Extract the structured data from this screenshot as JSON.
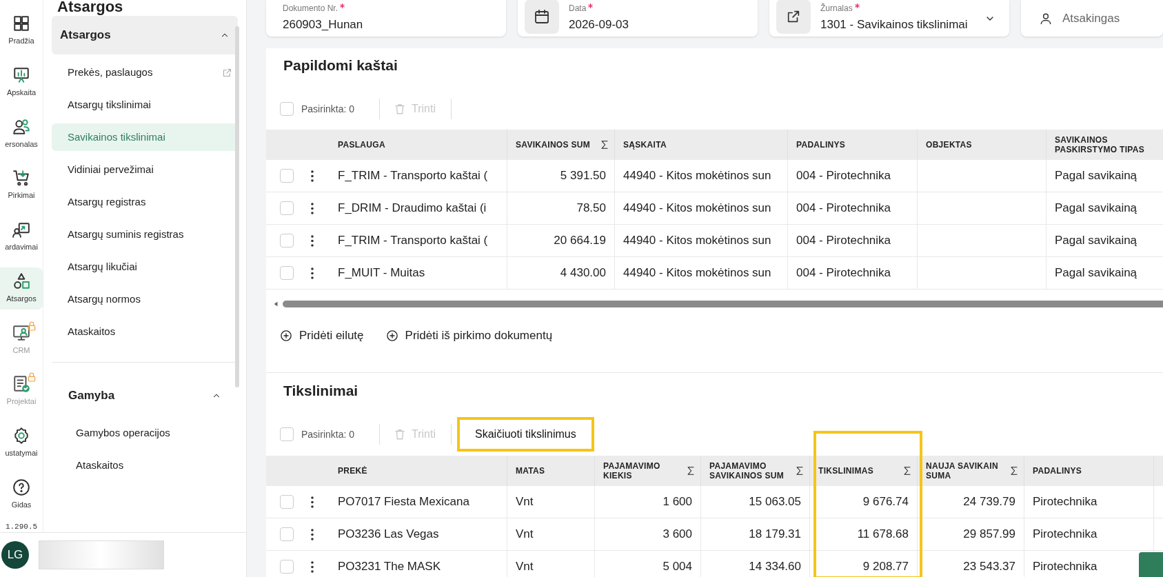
{
  "rail": {
    "items": [
      {
        "label": "Pradžia",
        "selected": false,
        "locked": false
      },
      {
        "label": "Apskaita",
        "selected": false,
        "locked": false
      },
      {
        "label": "ersonalas",
        "selected": false,
        "locked": false
      },
      {
        "label": "Pirkimai",
        "selected": false,
        "locked": false
      },
      {
        "label": "ardavimai",
        "selected": false,
        "locked": false
      },
      {
        "label": "Atsargos",
        "selected": true,
        "locked": false
      },
      {
        "label": "CRM",
        "selected": false,
        "locked": true
      },
      {
        "label": "Projektai",
        "selected": false,
        "locked": true
      },
      {
        "label": "ustatymai",
        "selected": false,
        "locked": false
      },
      {
        "label": "Gidas",
        "selected": false,
        "locked": false
      }
    ],
    "version": "1.290.5"
  },
  "sidebar": {
    "title": "Atsargos",
    "groups": [
      {
        "title": "Atsargos",
        "expanded": true,
        "items": [
          {
            "label": "Prekės, paslaugos",
            "selected": false,
            "external": true
          },
          {
            "label": "Atsargų tikslinimai",
            "selected": false,
            "external": false
          },
          {
            "label": "Savikainos tikslinimai",
            "selected": true,
            "external": false
          },
          {
            "label": "Vidiniai pervežimai",
            "selected": false,
            "external": false
          },
          {
            "label": "Atsargų registras",
            "selected": false,
            "external": false
          },
          {
            "label": "Atsargų suminis registras",
            "selected": false,
            "external": false
          },
          {
            "label": "Atsargų likučiai",
            "selected": false,
            "external": false
          },
          {
            "label": "Atsargų normos",
            "selected": false,
            "external": false
          },
          {
            "label": "Ataskaitos",
            "selected": false,
            "external": false
          }
        ]
      },
      {
        "title": "Gamyba",
        "expanded": true,
        "items": [
          {
            "label": "Gamybos operacijos",
            "selected": false,
            "external": false
          },
          {
            "label": "Ataskaitos",
            "selected": false,
            "external": false
          }
        ]
      }
    ]
  },
  "user": {
    "initials": "LG"
  },
  "header_fields": [
    {
      "kind": "text",
      "label": "Dokumento Nr.",
      "required": true,
      "value": "260903_Hunan"
    },
    {
      "kind": "date",
      "label": "Data",
      "required": true,
      "value": "2026-09-03"
    },
    {
      "kind": "select",
      "label": "Žurnalas",
      "required": true,
      "value": "1301 - Savikainos tikslinimai"
    },
    {
      "kind": "person",
      "placeholder": "Atsakingas"
    }
  ],
  "extra_costs": {
    "title": "Papildomi kaštai",
    "all_checked": false,
    "selected_count": "Pasirinkta: 0",
    "delete": "Trinti",
    "columns": [
      {
        "label": "PASLAUGA",
        "sum": false,
        "kind": "text"
      },
      {
        "label": "SAVIKAINOS SUM",
        "sum": true,
        "kind": "number"
      },
      {
        "label": "SĄSKAITA",
        "sum": false,
        "kind": "text"
      },
      {
        "label": "PADALINYS",
        "sum": false,
        "kind": "text"
      },
      {
        "label": "OBJEKTAS",
        "sum": false,
        "kind": "text"
      },
      {
        "label": "SAVIKAINOS\nPASKIRSTYMO TIPAS",
        "sum": false,
        "kind": "text"
      }
    ],
    "rows": [
      {
        "checked": false,
        "cells": [
          "F_TRIM - Transporto kaštai (",
          "5 391.50",
          "44940 - Kitos mokėtinos sun",
          "004 - Pirotechnika",
          "",
          "Pagal savikainą"
        ]
      },
      {
        "checked": false,
        "cells": [
          "F_DRIM - Draudimo kaštai (i",
          "78.50",
          "44940 - Kitos mokėtinos sun",
          "004 - Pirotechnika",
          "",
          "Pagal savikainą"
        ]
      },
      {
        "checked": false,
        "cells": [
          "F_TRIM - Transporto kaštai (",
          "20 664.19",
          "44940 - Kitos mokėtinos sun",
          "004 - Pirotechnika",
          "",
          "Pagal savikainą"
        ]
      },
      {
        "checked": false,
        "cells": [
          "F_MUIT - Muitas",
          "4 430.00",
          "44940 - Kitos mokėtinos sun",
          "004 - Pirotechnika",
          "",
          "Pagal savikainą"
        ]
      }
    ],
    "actions": [
      "Pridėti eilutę",
      "Pridėti iš pirkimo dokumentų"
    ]
  },
  "adjustments": {
    "title": "Tikslinimai",
    "all_checked": false,
    "selected_count": "Pasirinkta: 0",
    "delete": "Trinti",
    "calculate_button": {
      "label": "Skaičiuoti tikslinimus",
      "highlighted": true
    },
    "columns": [
      {
        "label": "PREKĖ",
        "sum": false,
        "kind": "text",
        "highlighted": false
      },
      {
        "label": "MATAS",
        "sum": false,
        "kind": "text",
        "highlighted": false
      },
      {
        "label": "PAJAMAVIMO\nKIEKIS",
        "sum": true,
        "kind": "number",
        "highlighted": false
      },
      {
        "label": "PAJAMAVIMO\nSAVIKAINOS SUM",
        "sum": true,
        "kind": "number",
        "highlighted": false
      },
      {
        "label": "TIKSLINIMAS",
        "sum": true,
        "kind": "number",
        "highlighted": true
      },
      {
        "label": "NAUJA SAVIKAIN\nSUMA",
        "sum": true,
        "kind": "number",
        "highlighted": false
      },
      {
        "label": "PADALINYS",
        "sum": false,
        "kind": "text",
        "highlighted": false
      }
    ],
    "rows": [
      {
        "checked": false,
        "cells": [
          "PO7017 Fiesta Mexicana",
          "Vnt",
          "1 600",
          "15 063.05",
          "9 676.74",
          "24 739.79",
          "Pirotechnika"
        ]
      },
      {
        "checked": false,
        "cells": [
          "PO3236 Las Vegas",
          "Vnt",
          "3 600",
          "18 179.31",
          "11 678.68",
          "29 857.99",
          "Pirotechnika"
        ]
      },
      {
        "checked": false,
        "cells": [
          "PO3231 The MASK",
          "Vnt",
          "5 004",
          "14 334.60",
          "9 208.77",
          "23 543.37",
          "Pirotechnika"
        ]
      }
    ]
  }
}
